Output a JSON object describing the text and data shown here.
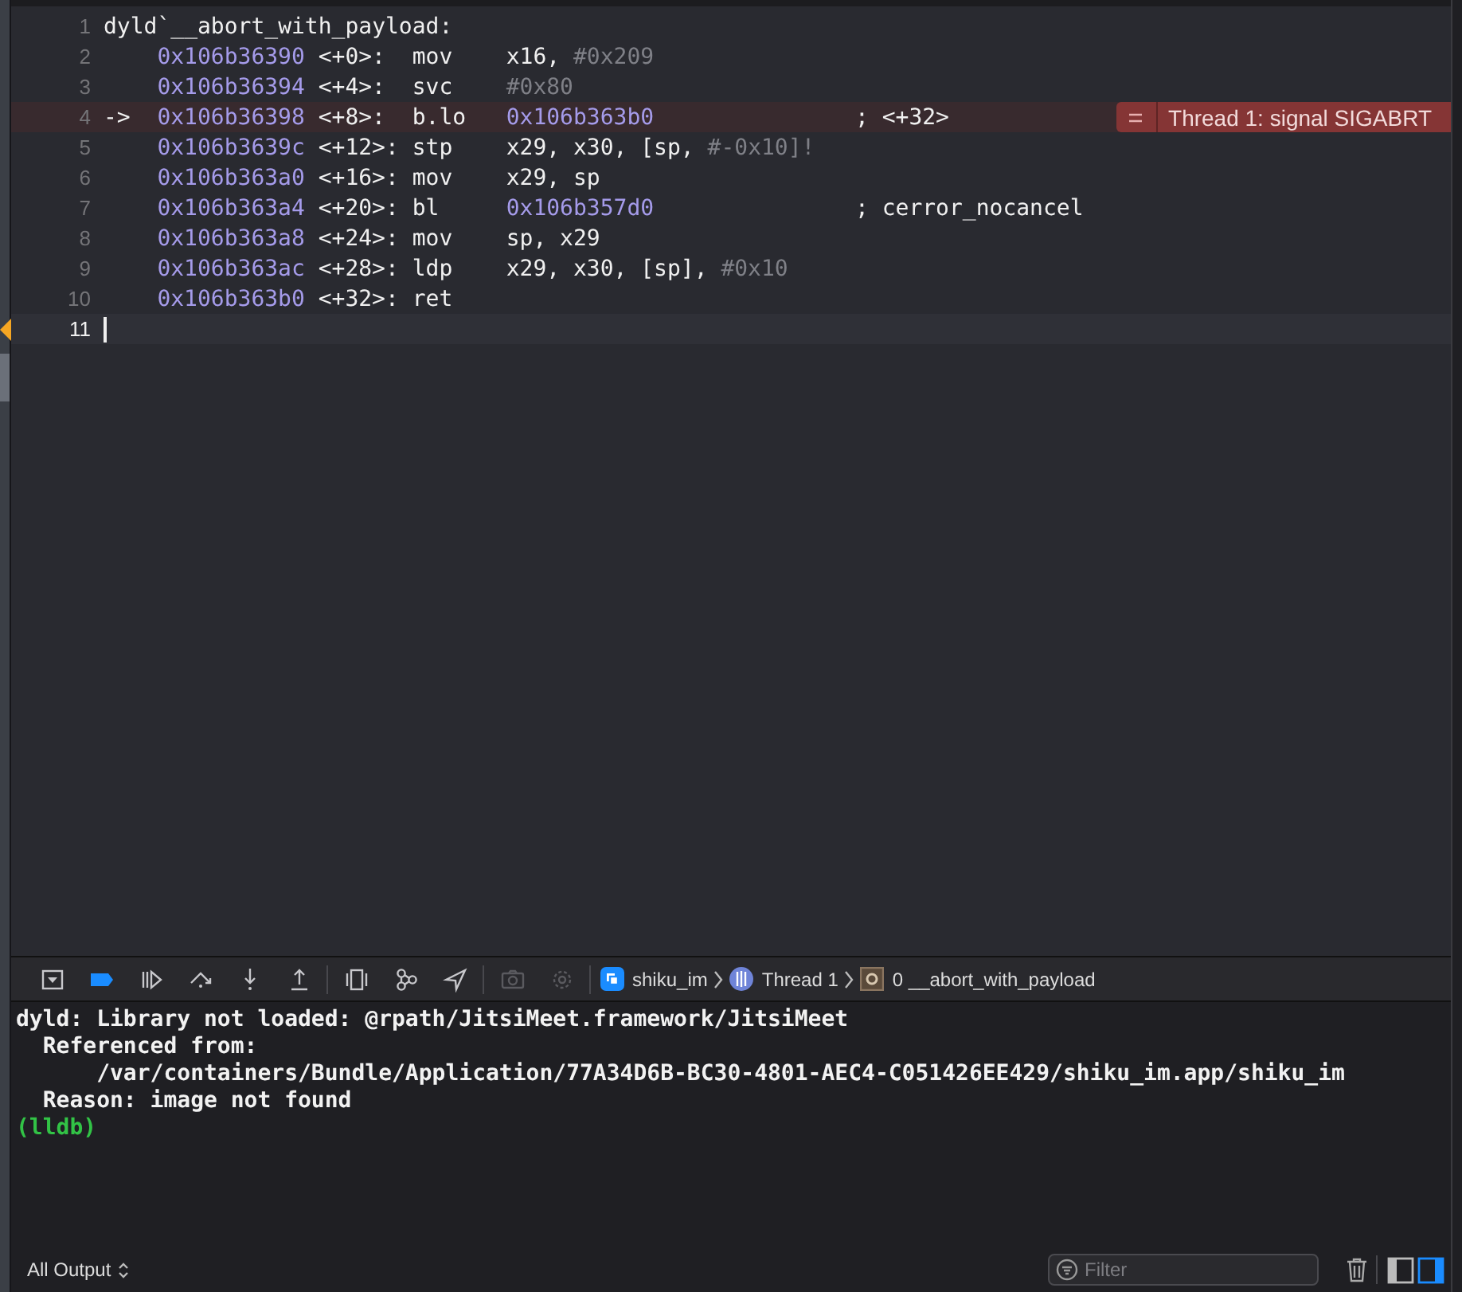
{
  "editor": {
    "lines": [
      {
        "number": "1",
        "current": false,
        "cursor": false,
        "label": "dyld`__abort_with_payload:"
      },
      {
        "number": "2",
        "current": false,
        "cursor": false,
        "address": "0x106b36390",
        "offset": "<+0>:",
        "mnemonic": "mov",
        "operands": "x16,",
        "immediate": "#0x209"
      },
      {
        "number": "3",
        "current": false,
        "cursor": false,
        "address": "0x106b36394",
        "offset": "<+4>:",
        "mnemonic": "svc",
        "immediate": "#0x80"
      },
      {
        "number": "4",
        "current": true,
        "cursor": false,
        "marker": "->",
        "address": "0x106b36398",
        "offset": "<+8>:",
        "mnemonic": "b.lo",
        "target": "0x106b363b0",
        "comment": "; <+32>",
        "annotation": "Thread 1: signal SIGABRT"
      },
      {
        "number": "5",
        "current": false,
        "cursor": false,
        "address": "0x106b3639c",
        "offset": "<+12>:",
        "mnemonic": "stp",
        "operands": "x29, x30, [sp,",
        "immediate": "#-0x10]!"
      },
      {
        "number": "6",
        "current": false,
        "cursor": false,
        "address": "0x106b363a0",
        "offset": "<+16>:",
        "mnemonic": "mov",
        "operands": "x29, sp"
      },
      {
        "number": "7",
        "current": false,
        "cursor": false,
        "address": "0x106b363a4",
        "offset": "<+20>:",
        "mnemonic": "bl",
        "target": "0x106b357d0",
        "comment": "; cerror_nocancel"
      },
      {
        "number": "8",
        "current": false,
        "cursor": false,
        "address": "0x106b363a8",
        "offset": "<+24>:",
        "mnemonic": "mov",
        "operands": "sp, x29"
      },
      {
        "number": "9",
        "current": false,
        "cursor": false,
        "address": "0x106b363ac",
        "offset": "<+28>:",
        "mnemonic": "ldp",
        "operands": "x29, x30, [sp],",
        "immediate": "#0x10"
      },
      {
        "number": "10",
        "current": false,
        "cursor": false,
        "address": "0x106b363b0",
        "offset": "<+32>:",
        "mnemonic": "ret"
      },
      {
        "number": "11",
        "current": false,
        "cursor": true
      }
    ]
  },
  "debug_bar": {
    "buttons": [
      {
        "kind": "hide",
        "on": false,
        "disabled": false
      },
      {
        "kind": "breakpoints",
        "on": true,
        "disabled": false
      },
      {
        "kind": "continue",
        "on": false,
        "disabled": false
      },
      {
        "kind": "step_over",
        "on": false,
        "disabled": false
      },
      {
        "kind": "step_into",
        "on": false,
        "disabled": false
      },
      {
        "kind": "step_out",
        "on": false,
        "disabled": false
      },
      {
        "kind": "view_debugger",
        "on": false,
        "disabled": false
      },
      {
        "kind": "memory_graph",
        "on": false,
        "disabled": false
      },
      {
        "kind": "location",
        "on": false,
        "disabled": false
      },
      {
        "kind": "camera",
        "on": false,
        "disabled": true
      },
      {
        "kind": "environment",
        "on": false,
        "disabled": true
      }
    ],
    "breadcrumbs": [
      {
        "kind": "app",
        "label": "shiku_im"
      },
      {
        "kind": "thread",
        "label": "Thread 1"
      },
      {
        "kind": "frame",
        "label": "0 __abort_with_payload"
      }
    ]
  },
  "console": {
    "lines": [
      {
        "kind": "output",
        "text": "dyld: Library not loaded: @rpath/JitsiMeet.framework/JitsiMeet"
      },
      {
        "kind": "output",
        "text": "  Referenced from:"
      },
      {
        "kind": "output",
        "text": "      /var/containers/Bundle/Application/77A34D6B-BC30-4801-AEC4-C051426EE429/shiku_im.app/shiku_im"
      },
      {
        "kind": "output",
        "text": "  Reason: image not found"
      },
      {
        "kind": "prompt",
        "text": "(lldb)"
      }
    ]
  },
  "bottom_bar": {
    "output_selector": "All Output",
    "filter": {
      "placeholder": "Filter"
    },
    "panels": [
      {
        "selected": false
      },
      {
        "selected": true
      }
    ]
  }
}
